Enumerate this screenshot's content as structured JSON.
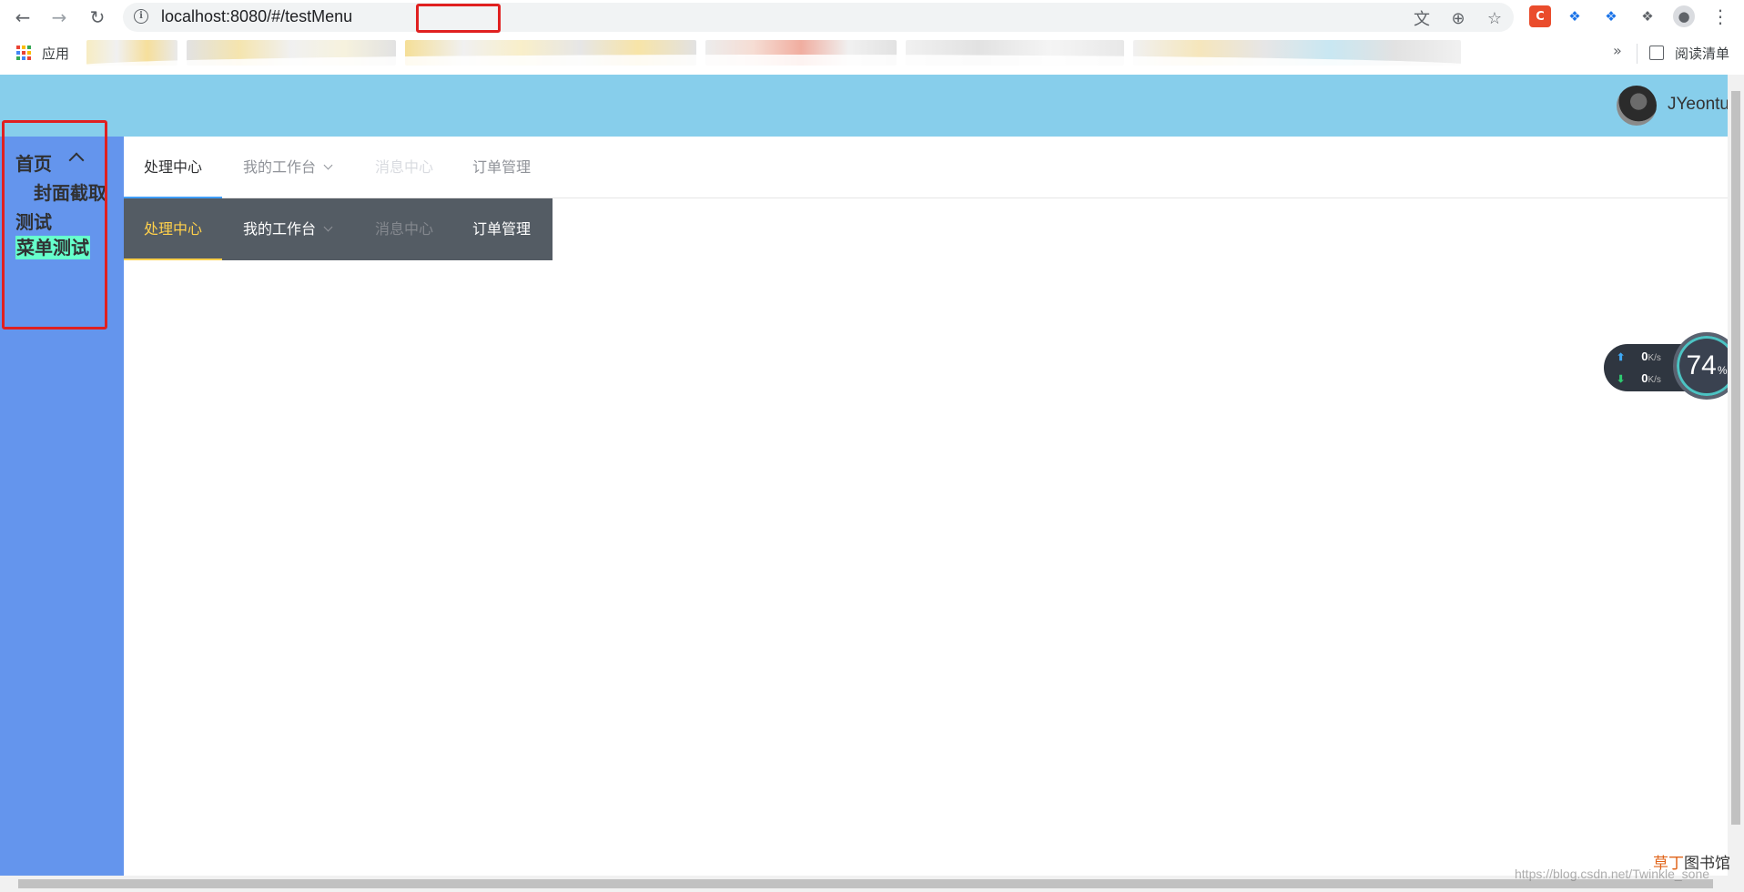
{
  "browser": {
    "url_host": "localhost:8080/#/",
    "url_path": "testMenu",
    "bookmarks_apps_label": "应用",
    "bookmarks_more": "»",
    "reading_list_label": "阅读清单"
  },
  "header": {
    "username": "JYeontu"
  },
  "sidebar": {
    "items": [
      {
        "label": "首页"
      },
      {
        "label": "封面截取"
      },
      {
        "label": "测试"
      },
      {
        "label": "菜单测试"
      }
    ]
  },
  "menu_light": {
    "items": [
      {
        "label": "处理中心"
      },
      {
        "label": "我的工作台"
      },
      {
        "label": "消息中心"
      },
      {
        "label": "订单管理"
      }
    ]
  },
  "menu_dark": {
    "items": [
      {
        "label": "处理中心"
      },
      {
        "label": "我的工作台"
      },
      {
        "label": "消息中心"
      },
      {
        "label": "订单管理"
      }
    ]
  },
  "speed_widget": {
    "up_value": "0",
    "down_value": "0",
    "unit": "K/s",
    "percent": "74",
    "percent_sign": "%"
  },
  "watermark": {
    "brand_red": "草丁",
    "brand_black": "图书馆",
    "url": "https://blog.csdn.net/Twinkle_sone"
  },
  "colors": {
    "header_bg": "#87ceeb",
    "sidebar_bg": "#6495ed",
    "dark_menu_bg": "#545c64",
    "dark_menu_active": "#ffd04b",
    "highlight_box": "#e02020",
    "selected_item_bg": "#66ffcc"
  }
}
